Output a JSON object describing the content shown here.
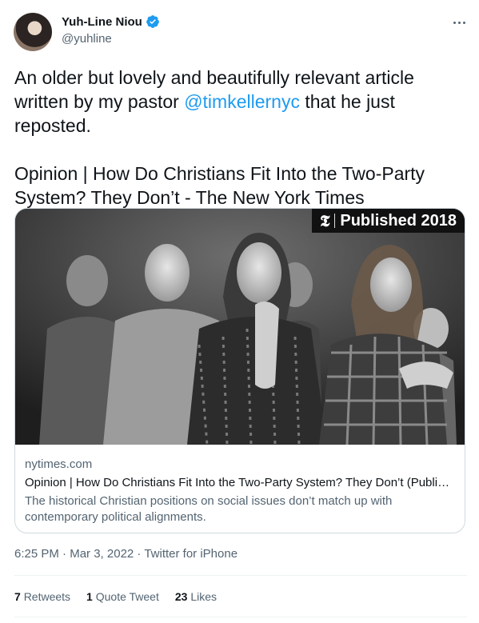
{
  "author": {
    "display_name": "Yuh-Line Niou",
    "handle": "@yuhline",
    "verified_icon": "verified-badge-icon",
    "more_icon": "more-options-icon"
  },
  "tweet": {
    "text_before_mention": "An older but lovely and beautifully relevant article written by my pastor ",
    "mention": "@timkellernyc",
    "text_after_mention": " that he just reposted.\n\nOpinion | How Do Christians Fit Into the Two-Party System? They Don’t - The New York Times"
  },
  "card": {
    "badge_logo": "𝕿",
    "badge_text": "Published 2018",
    "domain": "nytimes.com",
    "title": "Opinion | How Do Christians Fit Into the Two-Party System? They Don’t (Publis...",
    "description": "The historical Christian positions on social issues don’t match up with contemporary political alignments."
  },
  "meta": {
    "time": "6:25 PM",
    "date": "Mar 3, 2022",
    "source": "Twitter for iPhone",
    "sep": " · "
  },
  "stats": {
    "retweets_count": "7",
    "retweets_label": "Retweets",
    "quotes_count": "1",
    "quotes_label": "Quote Tweet",
    "likes_count": "23",
    "likes_label": "Likes"
  },
  "colors": {
    "accent": "#1d9bf0",
    "text": "#0f1419",
    "muted": "#536471",
    "border": "#cfd9de"
  }
}
